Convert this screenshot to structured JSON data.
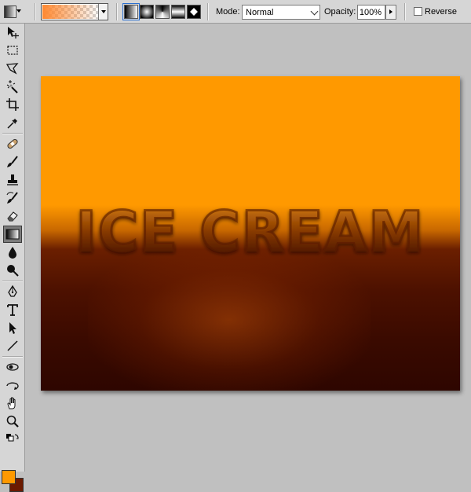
{
  "options_bar": {
    "mode_label": "Mode:",
    "mode_value": "Normal",
    "opacity_label": "Opacity:",
    "opacity_value": "100%",
    "reverse_label": "Reverse",
    "reverse_checked": false,
    "gradient_types": [
      "linear",
      "radial",
      "angle",
      "reflected",
      "diamond"
    ],
    "active_gradient_type": "linear"
  },
  "tools": [
    {
      "name": "move-tool",
      "icon": "move-icon"
    },
    {
      "name": "marquee-tool",
      "icon": "marquee-icon"
    },
    {
      "name": "lasso-tool",
      "icon": "lasso-icon"
    },
    {
      "name": "magic-wand-tool",
      "icon": "magic-wand-icon"
    },
    {
      "name": "crop-tool",
      "icon": "crop-icon"
    },
    {
      "name": "eyedropper-tool",
      "icon": "eyedropper-icon"
    },
    {
      "name": "healing-tool",
      "icon": "bandage-icon"
    },
    {
      "name": "brush-tool",
      "icon": "brush-icon"
    },
    {
      "name": "clone-stamp-tool",
      "icon": "stamp-icon"
    },
    {
      "name": "history-brush-tool",
      "icon": "history-brush-icon"
    },
    {
      "name": "eraser-tool",
      "icon": "eraser-icon"
    },
    {
      "name": "gradient-tool",
      "icon": "gradient-icon",
      "active": true
    },
    {
      "name": "blur-tool",
      "icon": "drop-icon"
    },
    {
      "name": "dodge-tool",
      "icon": "dodge-icon"
    },
    {
      "name": "pen-tool",
      "icon": "pen-icon"
    },
    {
      "name": "type-tool",
      "icon": "type-icon"
    },
    {
      "name": "path-selection-tool",
      "icon": "arrow-icon"
    },
    {
      "name": "line-tool",
      "icon": "line-icon"
    },
    {
      "name": "3d-rotate-tool",
      "icon": "3d-rotate-icon"
    },
    {
      "name": "3d-orbit-tool",
      "icon": "3d-orbit-icon"
    },
    {
      "name": "hand-tool",
      "icon": "hand-icon"
    },
    {
      "name": "zoom-tool",
      "icon": "zoom-icon"
    }
  ],
  "colors": {
    "foreground": "#ff9900",
    "background": "#6b1a00",
    "canvas_top": "#ff9900",
    "canvas_bottom": "#2e0600",
    "accent": "#2a6fd0"
  },
  "canvas": {
    "text": "ICE CREAM"
  }
}
